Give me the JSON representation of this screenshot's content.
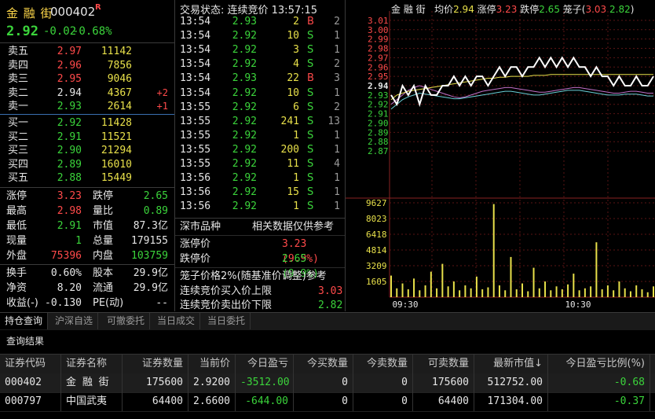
{
  "header": {
    "name": "金 融 街",
    "code": "000402",
    "flag": "R",
    "price": "2.92",
    "change": "-0.02",
    "change_pct": "-0.68%"
  },
  "asks": [
    {
      "label": "卖五",
      "price": "2.97",
      "vol": "11142",
      "delta": ""
    },
    {
      "label": "卖四",
      "price": "2.96",
      "vol": "7856",
      "delta": ""
    },
    {
      "label": "卖三",
      "price": "2.95",
      "vol": "9046",
      "delta": ""
    },
    {
      "label": "卖二",
      "price": "2.94",
      "vol": "4367",
      "delta": "+2"
    },
    {
      "label": "卖一",
      "price": "2.93",
      "vol": "2614",
      "delta": "+1"
    }
  ],
  "bids": [
    {
      "label": "买一",
      "price": "2.92",
      "vol": "11428"
    },
    {
      "label": "买二",
      "price": "2.91",
      "vol": "11521"
    },
    {
      "label": "买三",
      "price": "2.90",
      "vol": "21294"
    },
    {
      "label": "买四",
      "price": "2.89",
      "vol": "16010"
    },
    {
      "label": "买五",
      "price": "2.88",
      "vol": "15449"
    }
  ],
  "stats1": [
    {
      "l1": "涨停",
      "v1": "3.23",
      "c1": "r",
      "l2": "跌停",
      "v2": "2.65",
      "c2": "g"
    },
    {
      "l1": "最高",
      "v1": "2.98",
      "c1": "r",
      "l2": "量比",
      "v2": "0.89",
      "c2": "g"
    },
    {
      "l1": "最低",
      "v1": "2.91",
      "c1": "g",
      "l2": "市值",
      "v2": "87.3亿",
      "c2": "w"
    },
    {
      "l1": "现量",
      "v1": "1",
      "c1": "g",
      "l2": "总量",
      "v2": "179155",
      "c2": "w"
    },
    {
      "l1": "外盘",
      "v1": "75396",
      "c1": "r",
      "l2": "内盘",
      "v2": "103759",
      "c2": "g"
    }
  ],
  "stats2": [
    {
      "l1": "换手",
      "v1": "0.60%",
      "c1": "w",
      "l2": "股本",
      "v2": "29.9亿",
      "c2": "w"
    },
    {
      "l1": "净资",
      "v1": "8.20",
      "c1": "w",
      "l2": "流通",
      "v2": "29.9亿",
      "c2": "w"
    },
    {
      "l1": "收益(-)",
      "v1": "-0.130",
      "c1": "w",
      "l2": "PE(动)",
      "v2": "--",
      "c2": "w"
    }
  ],
  "ticks_header": "交易状态: 连续竞价 13:57:15",
  "ticks": [
    {
      "time": "13:54",
      "price": "2.93",
      "vol": "2",
      "bs": "B",
      "cnt": "2"
    },
    {
      "time": "13:54",
      "price": "2.92",
      "vol": "10",
      "bs": "S",
      "cnt": "1"
    },
    {
      "time": "13:54",
      "price": "2.92",
      "vol": "3",
      "bs": "S",
      "cnt": "1"
    },
    {
      "time": "13:54",
      "price": "2.92",
      "vol": "4",
      "bs": "S",
      "cnt": "2"
    },
    {
      "time": "13:54",
      "price": "2.93",
      "vol": "22",
      "bs": "B",
      "cnt": "3"
    },
    {
      "time": "13:54",
      "price": "2.92",
      "vol": "10",
      "bs": "S",
      "cnt": "1"
    },
    {
      "time": "13:55",
      "price": "2.92",
      "vol": "6",
      "bs": "S",
      "cnt": "2"
    },
    {
      "time": "13:55",
      "price": "2.92",
      "vol": "241",
      "bs": "S",
      "cnt": "13"
    },
    {
      "time": "13:55",
      "price": "2.92",
      "vol": "1",
      "bs": "S",
      "cnt": "1"
    },
    {
      "time": "13:55",
      "price": "2.92",
      "vol": "200",
      "bs": "S",
      "cnt": "1"
    },
    {
      "time": "13:55",
      "price": "2.92",
      "vol": "11",
      "bs": "S",
      "cnt": "4"
    },
    {
      "time": "13:56",
      "price": "2.92",
      "vol": "1",
      "bs": "S",
      "cnt": "1"
    },
    {
      "time": "13:56",
      "price": "2.92",
      "vol": "15",
      "bs": "S",
      "cnt": "1"
    },
    {
      "time": "13:56",
      "price": "2.92",
      "vol": "1",
      "bs": "S",
      "cnt": "1"
    }
  ],
  "info": {
    "market": "深市品种",
    "ref_note": "相关数据仅供参考",
    "limit_up_label": "涨停价",
    "limit_up": "3.23 (9.9%)",
    "limit_down_label": "跌停价",
    "limit_down": "2.65 (9.9%)",
    "cage_note": "笼子价格2%(随基准价调整)参考",
    "buy_upper_label": "连续竞价买入价上限",
    "buy_upper": "3.03",
    "sell_lower_label": "连续竞价卖出价下限",
    "sell_lower": "2.82"
  },
  "chart_title": {
    "name": "金 融 街",
    "avg_label": "均价",
    "avg": "2.94",
    "up_label": "涨停",
    "up": "3.23",
    "down_label": "跌停",
    "down": "2.65",
    "cage_label": "笼子(",
    "cage_lo": "3.03",
    "cage_hi": "2.82",
    "cage_end": ")"
  },
  "chart_data": {
    "type": "line",
    "price_ticks": [
      "3.01",
      "3.00",
      "2.99",
      "2.98",
      "2.97",
      "2.96",
      "2.95",
      "2.94",
      "2.93",
      "2.92",
      "2.91",
      "2.90",
      "2.89",
      "2.88",
      "2.87"
    ],
    "price_range": [
      2.865,
      3.015
    ],
    "highlight_tick": "2.94",
    "vol_ticks": [
      "9627",
      "8023",
      "6418",
      "4814",
      "3209",
      "1605"
    ],
    "vol_max": 9627,
    "time_labels": [
      "09:30",
      "10:30"
    ],
    "price": [
      2.93,
      2.92,
      2.94,
      2.93,
      2.94,
      2.92,
      2.94,
      2.93,
      2.93,
      2.94,
      2.94,
      2.95,
      2.94,
      2.95,
      2.94,
      2.95,
      2.95,
      2.94,
      2.95,
      2.96,
      2.95,
      2.96,
      2.96,
      2.95,
      2.96,
      2.96,
      2.97,
      2.96,
      2.97,
      2.96,
      2.97,
      2.96,
      2.97,
      2.96,
      2.96,
      2.95,
      2.96,
      2.95,
      2.95,
      2.94,
      2.95,
      2.94,
      2.94,
      2.95,
      2.94,
      2.94,
      2.95
    ],
    "avg": [
      2.925,
      2.93,
      2.932,
      2.934,
      2.935,
      2.936,
      2.937,
      2.938,
      2.939,
      2.94,
      2.941,
      2.942,
      2.943,
      2.944,
      2.945,
      2.946,
      2.947,
      2.948,
      2.948,
      2.949,
      2.949,
      2.95,
      2.95,
      2.95,
      2.95,
      2.951,
      2.951,
      2.951,
      2.952,
      2.952,
      2.952,
      2.952,
      2.952,
      2.952,
      2.952,
      2.952,
      2.952,
      2.952,
      2.952,
      2.952,
      2.952,
      2.952,
      2.952,
      2.952,
      2.952,
      2.952,
      2.952
    ],
    "index_a": [
      2.92,
      2.925,
      2.93,
      2.935,
      2.938,
      2.94,
      2.938,
      2.936,
      2.934,
      2.932,
      2.93,
      2.928,
      2.927,
      2.928,
      2.93,
      2.932,
      2.934,
      2.935,
      2.936,
      2.937,
      2.938,
      2.938,
      2.937,
      2.936,
      2.935,
      2.934,
      2.933,
      2.933,
      2.934,
      2.935,
      2.936,
      2.937,
      2.938,
      2.938,
      2.937,
      2.936,
      2.935,
      2.934,
      2.933,
      2.932,
      2.932,
      2.933,
      2.934,
      2.934,
      2.933,
      2.932,
      2.932
    ],
    "index_b": [
      2.915,
      2.92,
      2.925,
      2.928,
      2.93,
      2.932,
      2.931,
      2.93,
      2.929,
      2.928,
      2.927,
      2.926,
      2.926,
      2.927,
      2.928,
      2.929,
      2.93,
      2.931,
      2.932,
      2.933,
      2.934,
      2.934,
      2.933,
      2.932,
      2.931,
      2.93,
      2.93,
      2.931,
      2.932,
      2.933,
      2.934,
      2.935,
      2.935,
      2.935,
      2.934,
      2.933,
      2.932,
      2.931,
      2.93,
      2.93,
      2.93,
      2.931,
      2.931,
      2.931,
      2.93,
      2.929,
      2.929
    ],
    "volume": [
      2200,
      900,
      1400,
      800,
      1900,
      700,
      1200,
      2600,
      900,
      3400,
      1100,
      1600,
      700,
      1200,
      900,
      2100,
      800,
      1000,
      9500,
      1200,
      700,
      4100,
      800,
      1400,
      600,
      3000,
      900,
      1600,
      700,
      1100,
      800,
      1300,
      2400,
      700,
      900,
      1100,
      5600,
      800,
      1200,
      700,
      1600,
      900,
      600,
      1200,
      800,
      500,
      1100
    ]
  },
  "tabs": [
    "持仓查询",
    "沪深自选",
    "可撤委托",
    "当日成交",
    "当日委托"
  ],
  "result_title": "查询结果",
  "table": {
    "columns": [
      "证券代码",
      "证券名称",
      "证券数量",
      "当前价",
      "今日盈亏",
      "今买数量",
      "今卖数量",
      "可卖数量",
      "最新市值↓",
      "今日盈亏比例(%)"
    ],
    "rows": [
      [
        "000402",
        "金 融 街",
        "175600",
        "2.9200",
        "-3512.00",
        "0",
        "0",
        "175600",
        "512752.00",
        "-0.68"
      ],
      [
        "000797",
        "中国武夷",
        "64400",
        "2.6600",
        "-644.00",
        "0",
        "0",
        "64400",
        "171304.00",
        "-0.37"
      ]
    ]
  }
}
